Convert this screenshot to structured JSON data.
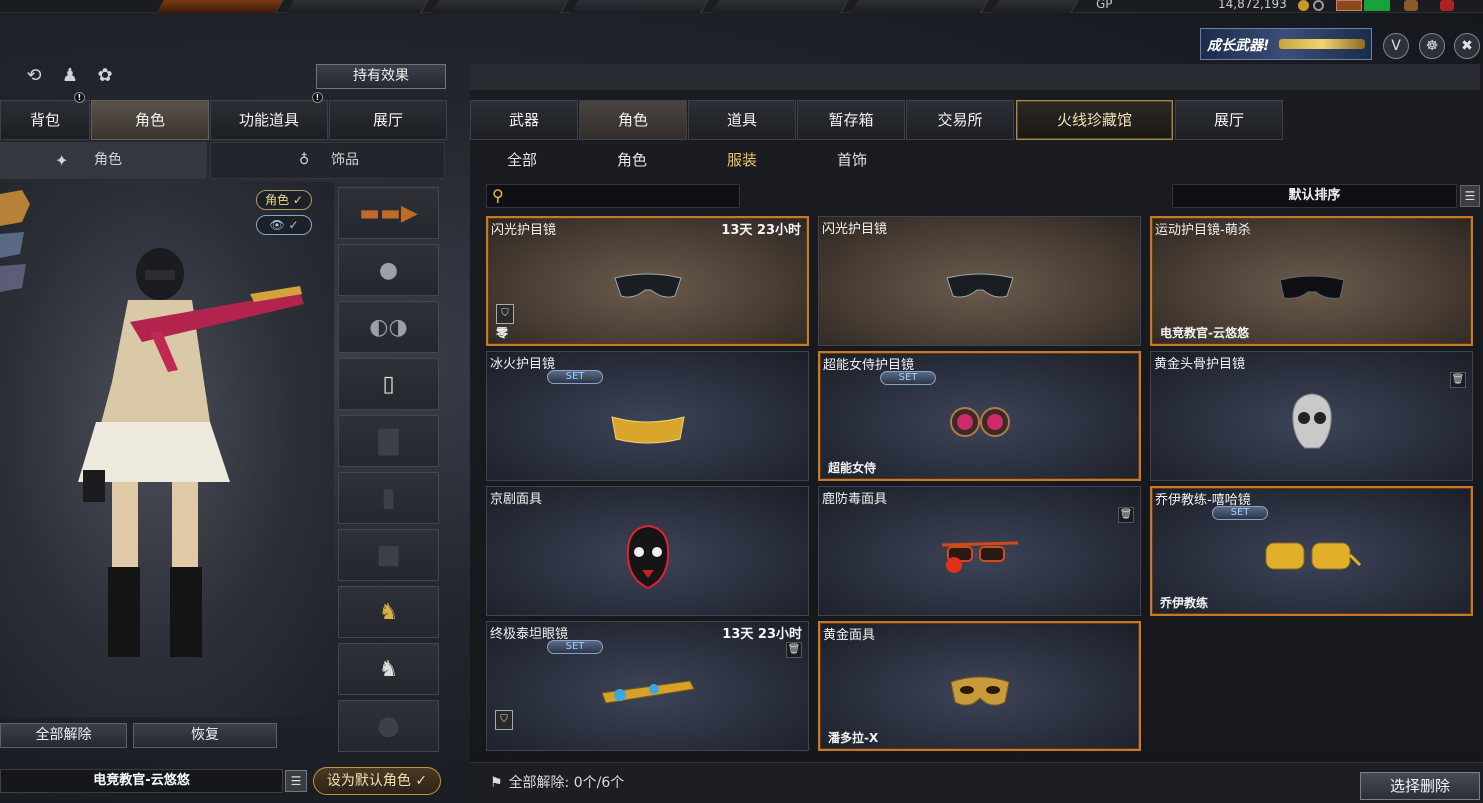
{
  "topbar": {
    "gp_label": "GP",
    "gp_value": "14,872,193"
  },
  "promo": {
    "text": "成长武器!"
  },
  "left": {
    "hold_effect_button": "持有效果",
    "tabs": [
      "背包",
      "角色",
      "功能道具",
      "展厅"
    ],
    "alerts": [
      "!",
      "!"
    ],
    "subtabs": [
      "角色",
      "饰品"
    ],
    "chip_role": "角色 ✓",
    "chip_eye": "👁 ✓",
    "buttons": {
      "unequip_all": "全部解除",
      "restore": "恢复"
    },
    "char_name": "电竞教官-云悠悠",
    "set_default": "设为默认角色 ✓"
  },
  "right": {
    "tabs": [
      "武器",
      "角色",
      "道具",
      "暂存箱",
      "交易所",
      "火线珍藏馆",
      "展厅"
    ],
    "subtabs": [
      "全部",
      "角色",
      "服装",
      "首饰"
    ],
    "search_placeholder": "",
    "sort": "默认排序",
    "cards": [
      {
        "name": "闪光护目镜",
        "time": "13天 23小时",
        "set": "",
        "owner": "零"
      },
      {
        "name": "闪光护目镜",
        "time": "",
        "set": "",
        "owner": ""
      },
      {
        "name": "运动护目镜-萌杀",
        "time": "",
        "set": "",
        "owner": "电竞教官-云悠悠"
      },
      {
        "name": "冰火护目镜",
        "time": "",
        "set": "SET",
        "owner": ""
      },
      {
        "name": "超能女侍护目镜",
        "time": "",
        "set": "SET",
        "owner": "超能女侍"
      },
      {
        "name": "黄金头骨护目镜",
        "time": "",
        "set": "",
        "owner": ""
      },
      {
        "name": "京剧面具",
        "time": "",
        "set": "",
        "owner": ""
      },
      {
        "name": "鹿防毒面具",
        "time": "",
        "set": "",
        "owner": ""
      },
      {
        "name": "乔伊教练-嘻哈镜",
        "time": "",
        "set": "SET",
        "owner": "乔伊教练"
      },
      {
        "name": "终极泰坦眼镜",
        "time": "13天 23小时",
        "set": "SET",
        "owner": ""
      },
      {
        "name": "黄金面具",
        "time": "",
        "set": "",
        "owner": "潘多拉-X"
      }
    ],
    "bottom_status": "全部解除: 0个/6个",
    "select_delete": "选择删除"
  },
  "colors": {
    "accent_gold": "#c57a2a",
    "active_subtab": "#ecc76a",
    "set_badge": "#9fd0ff"
  }
}
